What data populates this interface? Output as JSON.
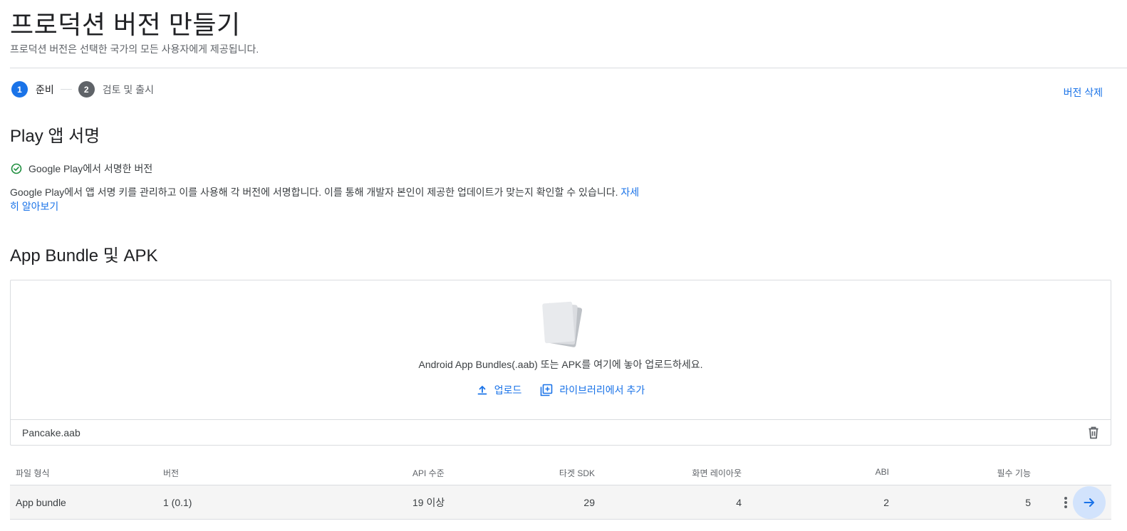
{
  "header": {
    "title": "프로덕션 버전 만들기",
    "subtitle": "프로덕션 버전은 선택한 국가의 모든 사용자에게 제공됩니다."
  },
  "stepper": {
    "steps": [
      {
        "number": "1",
        "label": "준비",
        "state": "active"
      },
      {
        "number": "2",
        "label": "검토 및 출시",
        "state": "inactive"
      }
    ]
  },
  "actions": {
    "delete_version": "버전 삭제"
  },
  "signing": {
    "title": "Play 앱 서명",
    "status": "Google Play에서 서명한 버전",
    "description": "Google Play에서 앱 서명 키를 관리하고 이를 사용해 각 버전에 서명합니다. 이를 통해 개발자 본인이 제공한 업데이트가 맞는지 확인할 수 있습니다.",
    "learn_more": "자세히 알아보기"
  },
  "bundles": {
    "title": "App Bundle 및 APK",
    "drop_text": "Android App Bundles(.aab) 또는 APK를 여기에 놓아 업로드하세요.",
    "upload_label": "업로드",
    "add_from_library_label": "라이브러리에서 추가",
    "file_name": "Pancake.aab"
  },
  "table": {
    "headers": {
      "type": "파일 형식",
      "version": "버전",
      "api": "API 수준",
      "target_sdk": "타겟 SDK",
      "screen_layouts": "화면 레이아웃",
      "abi": "ABI",
      "required_features": "필수 기능"
    },
    "rows": [
      {
        "type": "App bundle",
        "version": "1 (0.1)",
        "api": "19 이상",
        "target_sdk": "29",
        "screen_layouts": "4",
        "abi": "2",
        "required_features": "5"
      }
    ]
  },
  "colors": {
    "accent": "#1a73e8",
    "success": "#1e8e3e",
    "text_secondary": "#5f6368"
  }
}
